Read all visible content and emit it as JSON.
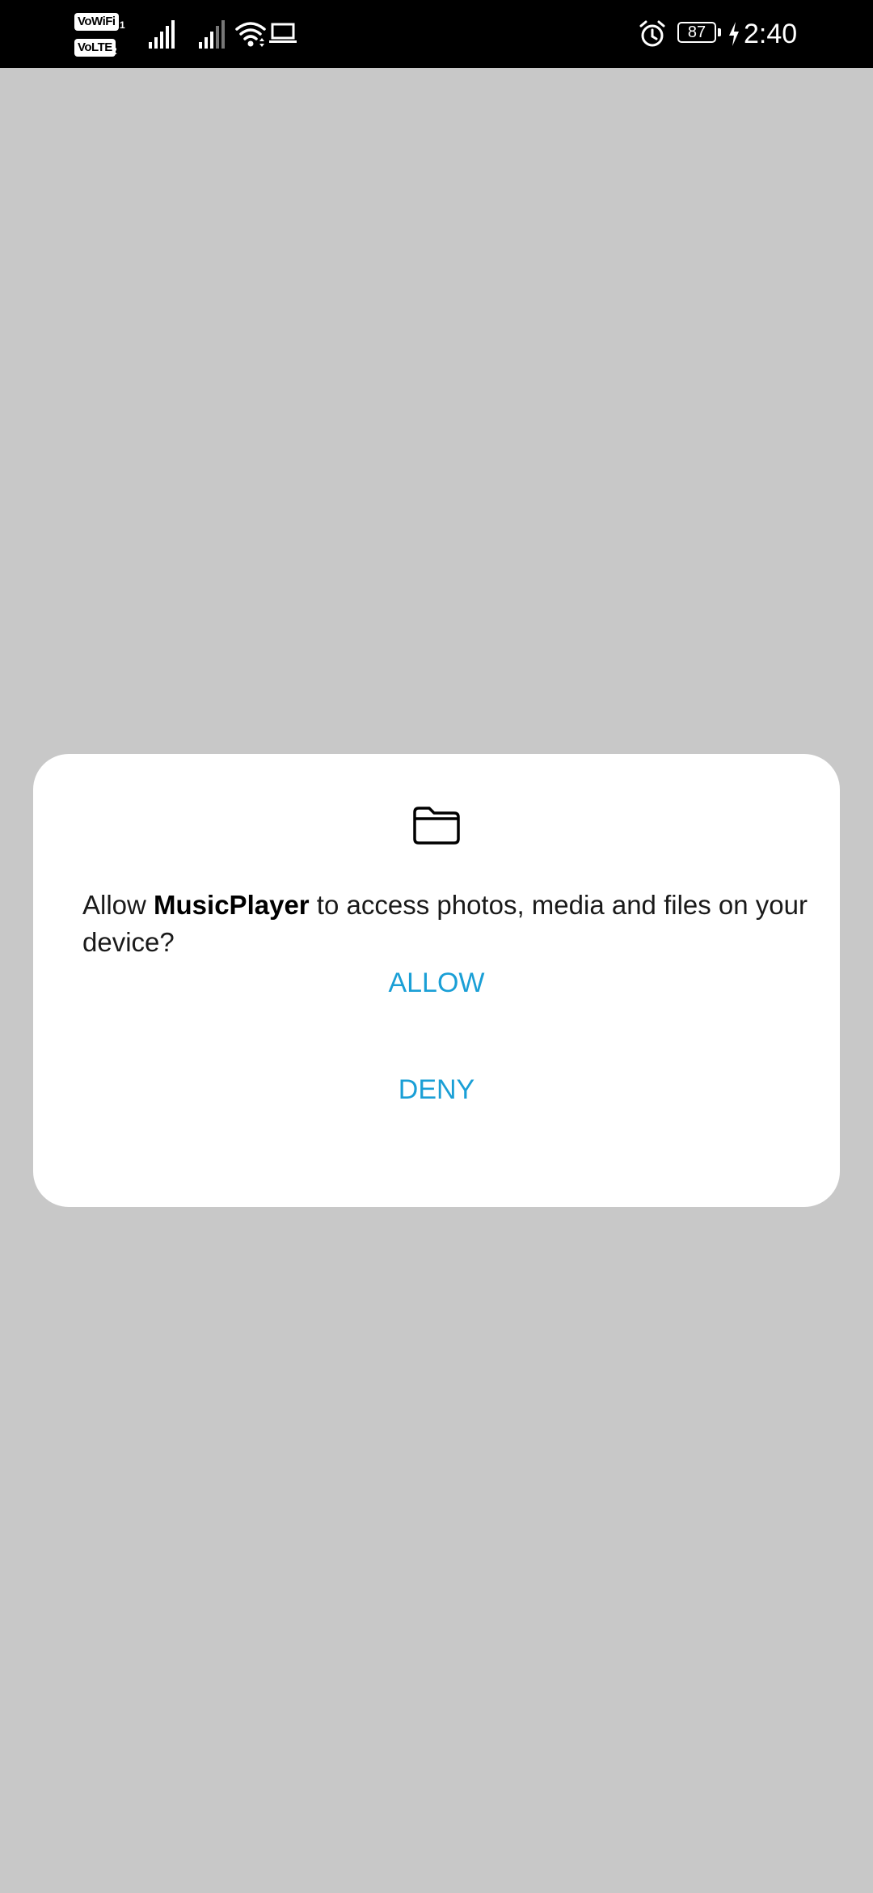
{
  "status_bar": {
    "sim1_badge": "VoWiFi",
    "sim1_number": "1",
    "sim2_badge": "VoLTE",
    "sim2_number": "2",
    "battery_level": "87",
    "time": "2:40",
    "icons": [
      "vowifi-icon",
      "volte-icon",
      "signal-icon",
      "signal-icon",
      "wifi-icon",
      "laptop-icon",
      "alarm-icon",
      "battery-icon",
      "charging-icon"
    ]
  },
  "dialog": {
    "icon": "folder-icon",
    "message_prefix": "Allow ",
    "app_name": "MusicPlayer",
    "message_suffix": " to access photos, media and files on your device?",
    "allow_label": "ALLOW",
    "deny_label": "DENY",
    "accent_color": "#1a9fd6"
  },
  "colors": {
    "background": "#c8c8c8",
    "status_bar": "#000000",
    "dialog": "#ffffff"
  }
}
